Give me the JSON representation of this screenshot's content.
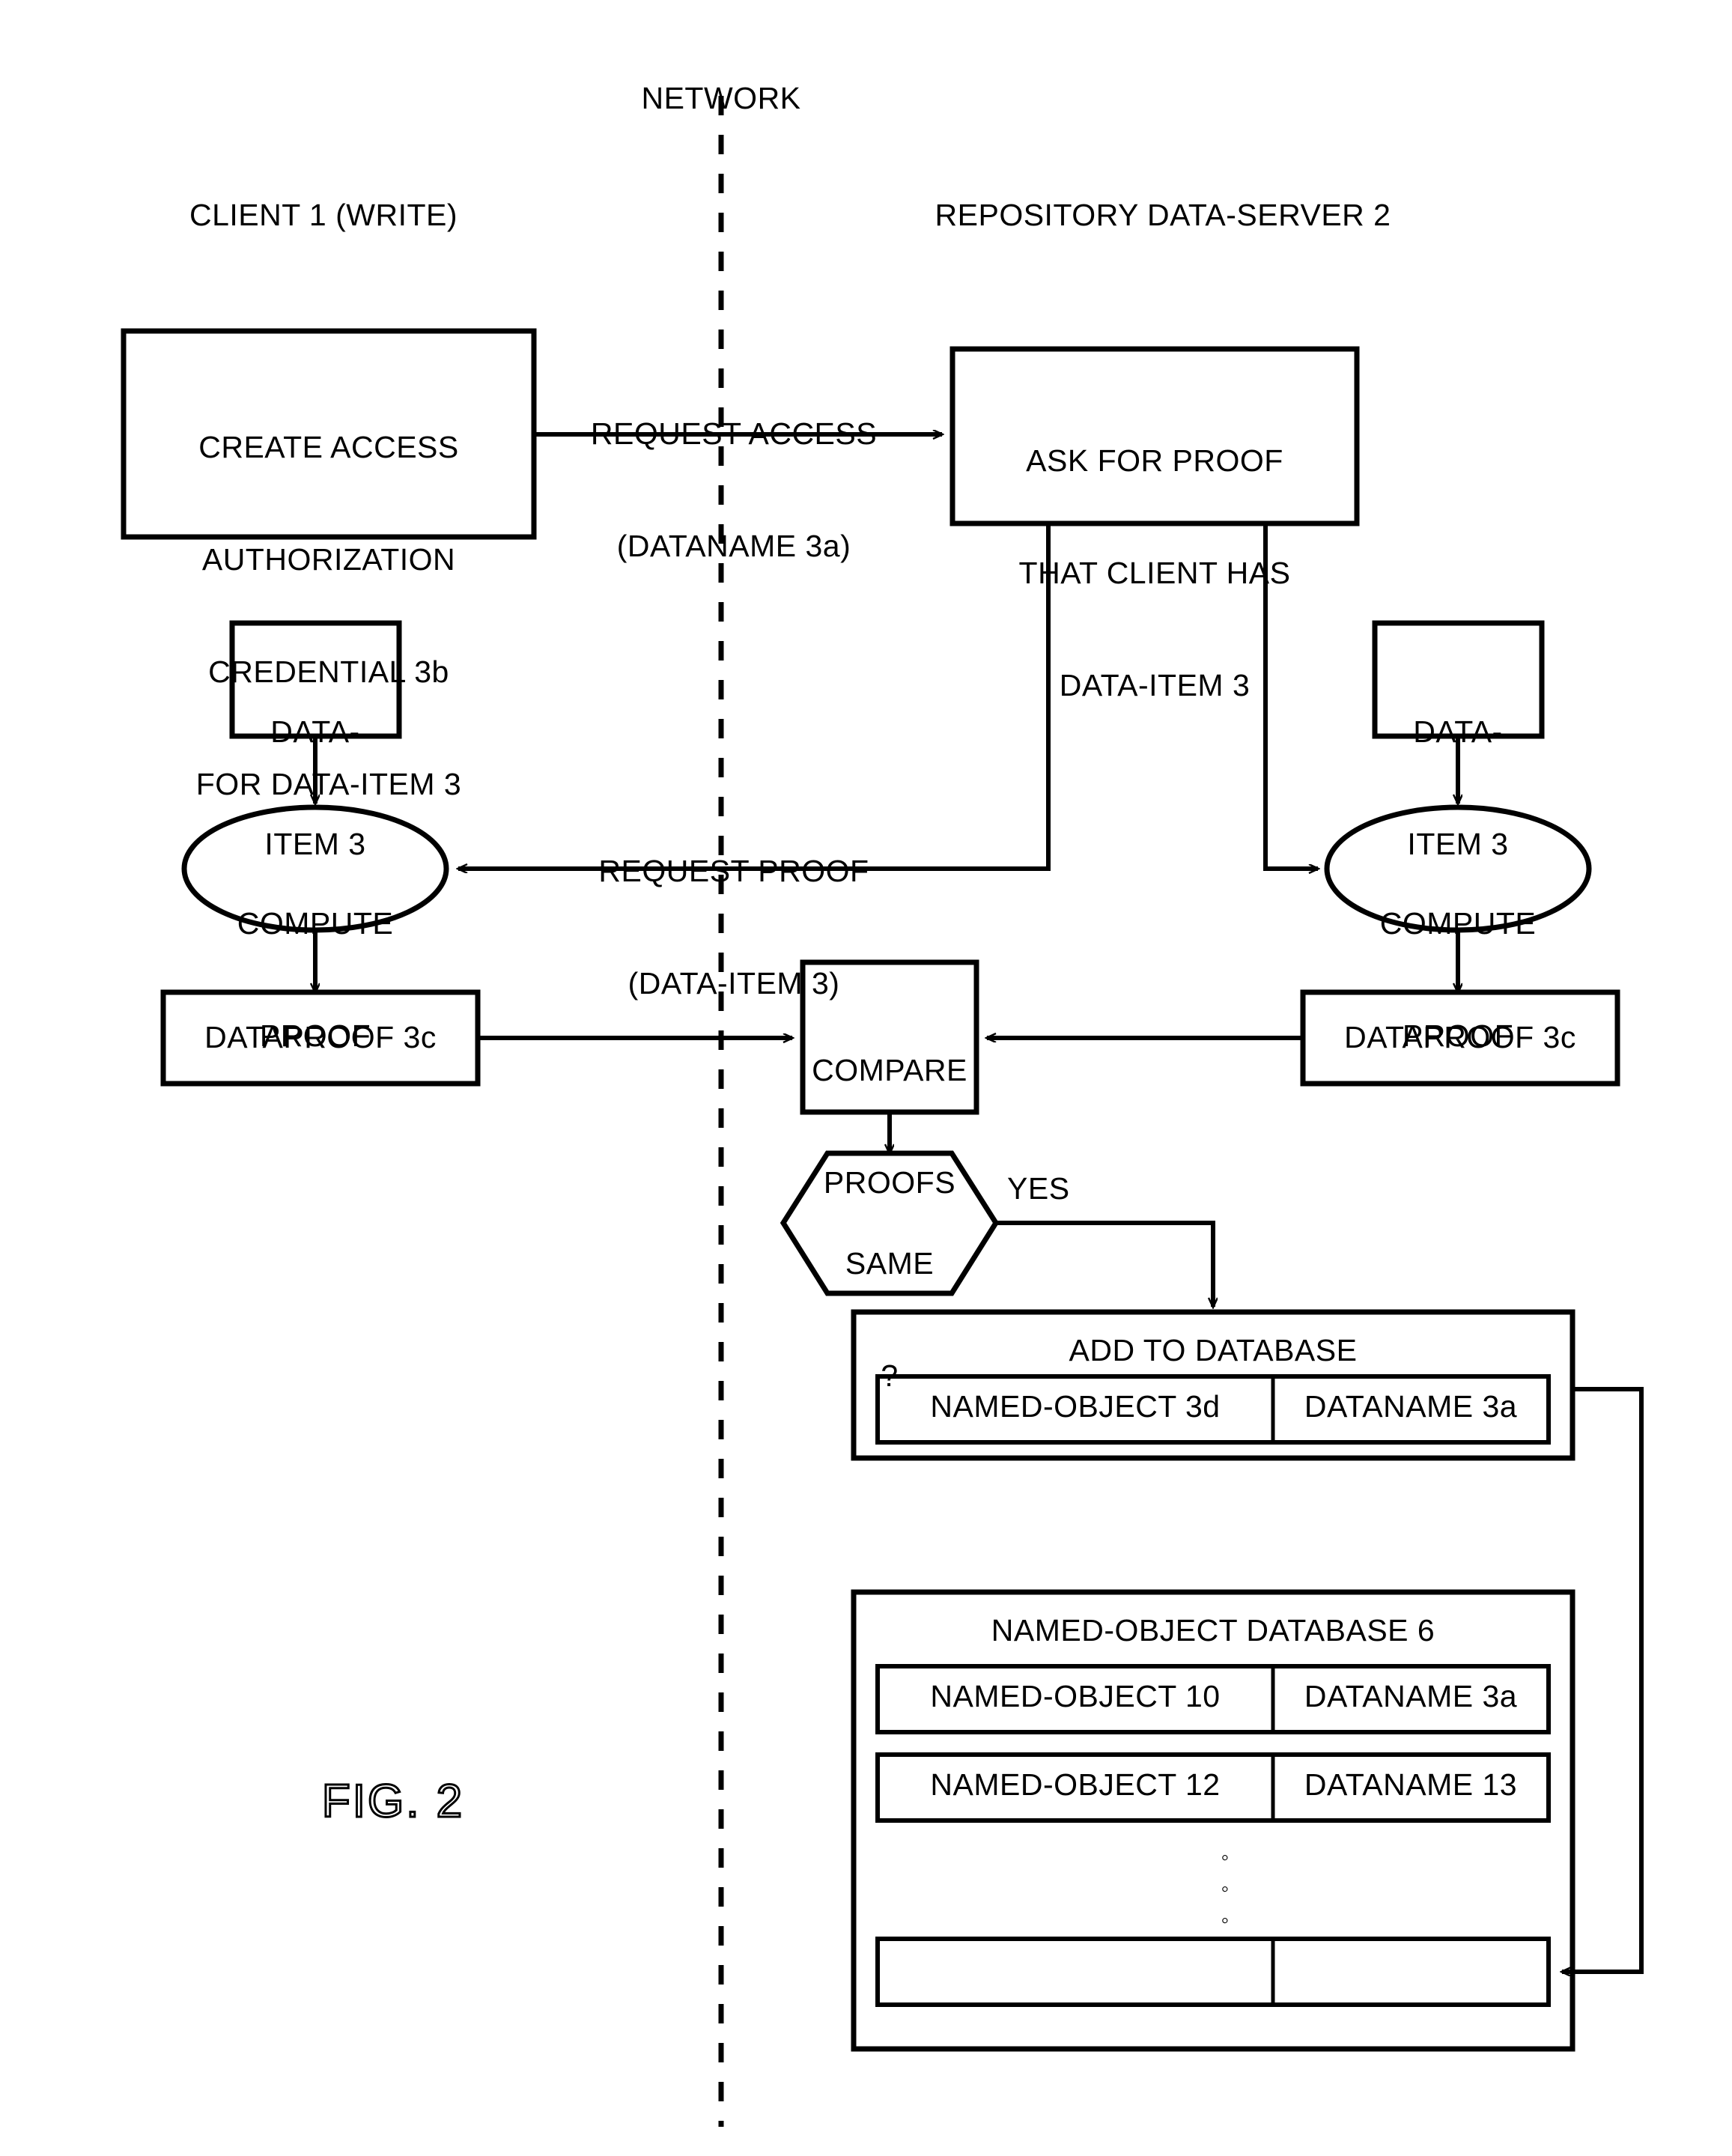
{
  "figure": {
    "label": "FIG. 2",
    "network_label": "NETWORK"
  },
  "columns": [
    {
      "id": "client",
      "title": "CLIENT 1 (WRITE)"
    },
    {
      "id": "server",
      "title": "REPOSITORY DATA-SERVER 2"
    }
  ],
  "nodes": {
    "create_access": {
      "lines": [
        "CREATE ACCESS",
        "AUTHORIZATION",
        "CREDENTIAL 3b",
        "FOR DATA-ITEM 3"
      ]
    },
    "ask_for_proof": {
      "lines": [
        "ASK FOR PROOF",
        "THAT CLIENT HAS",
        "DATA-ITEM 3"
      ]
    },
    "client_data_item": {
      "lines": [
        "DATA-",
        "ITEM 3"
      ]
    },
    "server_data_item": {
      "lines": [
        "DATA-",
        "ITEM 3"
      ]
    },
    "client_compute_proof": {
      "lines": [
        "COMPUTE",
        "PROOF"
      ]
    },
    "server_compute_proof": {
      "lines": [
        "COMPUTE",
        "PROOF"
      ]
    },
    "client_dataproof": {
      "lines": [
        "DATAPROOF 3c"
      ]
    },
    "server_dataproof": {
      "lines": [
        "DATAPROOF 3c"
      ]
    },
    "compare_proofs": {
      "lines": [
        "COMPARE",
        "PROOFS"
      ]
    },
    "same_decision": {
      "lines": [
        "SAME",
        "?"
      ],
      "yes_label": "YES"
    },
    "add_to_database": {
      "title": "ADD TO DATABASE",
      "row": {
        "object": "NAMED-OBJECT 3d",
        "dataname": "DATANAME 3a"
      }
    },
    "named_object_database": {
      "title": "NAMED-OBJECT DATABASE 6",
      "rows": [
        {
          "object": "NAMED-OBJECT 10",
          "dataname": "DATANAME 3a"
        },
        {
          "object": "NAMED-OBJECT 12",
          "dataname": "DATANAME 13"
        },
        {
          "object": "",
          "dataname": ""
        }
      ],
      "ellipsis": "◦\n◦\n◦"
    }
  },
  "edges": {
    "request_access": {
      "lines": [
        "REQUEST ACCESS",
        "(DATANAME 3a)"
      ]
    },
    "request_proof": {
      "lines": [
        "REQUEST PROOF",
        "(DATA-ITEM 3)"
      ]
    }
  },
  "colors": {
    "stroke": "#000000",
    "background": "#ffffff"
  }
}
